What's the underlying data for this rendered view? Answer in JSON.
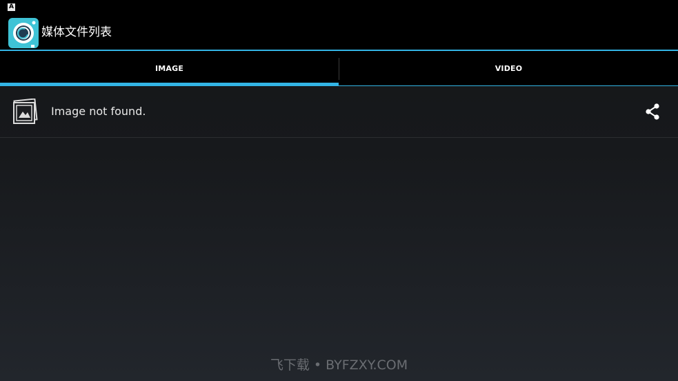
{
  "status_bar": {
    "notification_glyph": "A"
  },
  "action_bar": {
    "title": "媒体文件列表",
    "icon": "camera-app-icon"
  },
  "tabs": [
    {
      "label": "IMAGE",
      "selected": true
    },
    {
      "label": "VIDEO",
      "selected": false
    }
  ],
  "list": {
    "items": [
      {
        "label": "Image not found.",
        "icon": "image-placeholder-icon",
        "action_icon": "share-icon"
      }
    ]
  },
  "watermark": "飞下载 • BYFZXY.COM",
  "colors": {
    "accent": "#33b5e5",
    "app_icon_bg": "#3fc3d6",
    "background": "#17191c"
  }
}
